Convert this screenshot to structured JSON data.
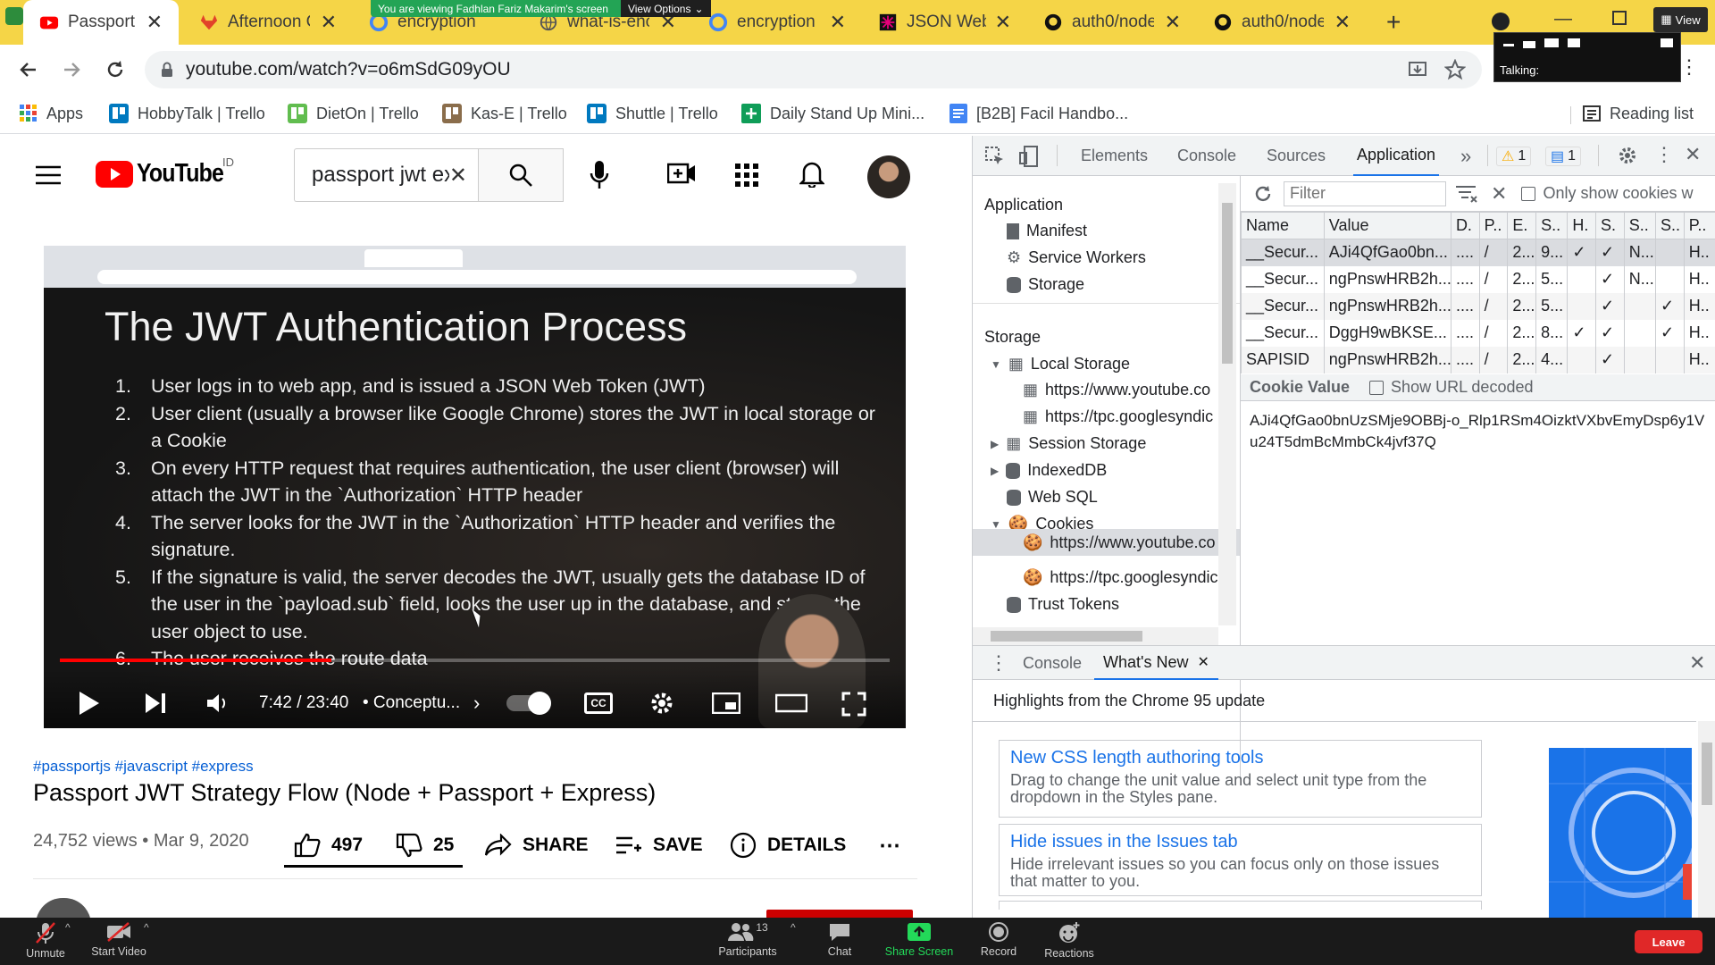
{
  "browser": {
    "tabs": [
      {
        "label": "Passport JW",
        "icon": "youtube-icon",
        "active": true
      },
      {
        "label": "Afternoon C",
        "icon": "gitlab-icon"
      },
      {
        "label": "encryption",
        "icon": "google-icon"
      },
      {
        "label": "what-is-enc",
        "icon": "globe-icon"
      },
      {
        "label": "encryption",
        "icon": "google-icon"
      },
      {
        "label": "JSON Web",
        "icon": "jwt-icon"
      },
      {
        "label": "auth0/node",
        "icon": "github-icon"
      },
      {
        "label": "auth0/node",
        "icon": "github-icon"
      }
    ],
    "url": "youtube.com/watch?v=o6mSdG09yOU",
    "bookmarks": [
      {
        "label": "Apps",
        "icon": "apps-grid-icon"
      },
      {
        "label": "HobbyTalk | Trello",
        "icon": "trello-icon"
      },
      {
        "label": "DietOn | Trello",
        "icon": "trello-icon"
      },
      {
        "label": "Kas-E | Trello",
        "icon": "trello-icon"
      },
      {
        "label": "Shuttle | Trello",
        "icon": "trello-icon"
      },
      {
        "label": "Daily Stand Up Mini...",
        "icon": "sheets-icon"
      },
      {
        "label": "[B2B] Facil Handbo...",
        "icon": "docs-icon"
      }
    ],
    "reading_list": "Reading list"
  },
  "screen_share": {
    "banner": "You are viewing Fadhlan Fariz Makarim's screen",
    "view_options": "View Options",
    "view_label": "View",
    "talking_label": "Talking:"
  },
  "youtube": {
    "logo_text": "YouTube",
    "region": "ID",
    "search_value": "passport jwt ex",
    "video": {
      "slide_title": "The JWT Authentication Process",
      "slide_points": [
        {
          "n": "1.",
          "text": "User logs in to web app, and is issued a JSON Web Token (JWT)"
        },
        {
          "n": "2.",
          "text": "User client (usually a browser like Google Chrome) stores the JWT in local storage or a Cookie"
        },
        {
          "n": "3.",
          "text": "On every HTTP request that requires authentication, the user client (browser) will attach the JWT in the `Authorization` HTTP header"
        },
        {
          "n": "4.",
          "text": "The server looks for the JWT in the `Authorization` HTTP header and verifies the signature."
        },
        {
          "n": "5.",
          "text": "If the signature is valid, the server decodes the JWT, usually gets the database ID of the user in the `payload.sub` field, looks the user up in the database, and stores the user object to use."
        },
        {
          "n": "6.",
          "text": "The user receives the route data"
        }
      ],
      "time": "7:42 / 23:40",
      "chapter": "• Conceptu...",
      "progress": 0.327
    },
    "tags": "#passportjs #javascript #express",
    "title": "Passport JWT Strategy Flow (Node + Passport + Express)",
    "views": "24,752 views • Mar 9, 2020",
    "likes": "497",
    "dislikes": "25",
    "share": "SHARE",
    "save": "SAVE",
    "details": "DETAILS"
  },
  "devtools": {
    "tabs": [
      "Elements",
      "Console",
      "Sources",
      "Application"
    ],
    "active_tab": "Application",
    "warnings": "1",
    "messages": "1",
    "sidebar": {
      "application_header": "Application",
      "application_items": [
        "Manifest",
        "Service Workers",
        "Storage"
      ],
      "storage_header": "Storage",
      "local_storage": "Local Storage",
      "local_items": [
        "https://www.youtube.co",
        "https://tpc.googlesyndic"
      ],
      "session_storage": "Session Storage",
      "indexeddb": "IndexedDB",
      "websql": "Web SQL",
      "cookies": "Cookies",
      "cookie_items": [
        "https://www.youtube.co",
        "https://tpc.googlesyndic"
      ],
      "trust_tokens": "Trust Tokens"
    },
    "filter_placeholder": "Filter",
    "only_show_cookies": "Only show cookies w",
    "columns": [
      "Name",
      "Value",
      "D.",
      "P..",
      "E.",
      "S..",
      "H.",
      "S.",
      "S..",
      "S..",
      "P.."
    ],
    "rows": [
      [
        "__Secur...",
        "AJi4QfGao0bn...",
        "....",
        "/",
        "2...",
        "9...",
        "✓",
        "✓",
        "N...",
        "",
        "H.."
      ],
      [
        "__Secur...",
        "ngPnswHRB2h...",
        "....",
        "/",
        "2...",
        "5...",
        "",
        "✓",
        "N...",
        "",
        "H.."
      ],
      [
        "__Secur...",
        "ngPnswHRB2h...",
        "....",
        "/",
        "2...",
        "5...",
        "",
        "✓",
        "",
        "✓",
        "H.."
      ],
      [
        "__Secur...",
        "DggH9wBKSE...",
        "....",
        "/",
        "2...",
        "8...",
        "✓",
        "✓",
        "",
        "✓",
        "H.."
      ],
      [
        "SAPISID",
        "ngPnswHRB2h...",
        "....",
        "/",
        "2...",
        "4...",
        "",
        "✓",
        "",
        "",
        "H.."
      ]
    ],
    "cookie_value_label": "Cookie Value",
    "show_url_decoded": "Show URL decoded",
    "cookie_value": "AJi4QfGao0bnUzSMje9OBBj-o_Rlp1RSm4OizktVXbvEmyDsp6y1Vu24T5dmBcMmbCk4jvf37Q",
    "drawer_tabs": [
      "Console",
      "What's New"
    ],
    "drawer_headline": "Highlights from the Chrome 95 update",
    "cards": [
      {
        "title": "New CSS length authoring tools",
        "body": "Drag to change the unit value and select unit type from the dropdown in the Styles pane."
      },
      {
        "title": "Hide issues in the Issues tab",
        "body": "Hide irrelevant issues so you can focus only on those issues that matter to you."
      }
    ]
  },
  "zoom": {
    "unmute": "Unmute",
    "start_video": "Start Video",
    "participants": "Participants",
    "participant_count": "13",
    "chat": "Chat",
    "share_screen": "Share Screen",
    "record": "Record",
    "reactions": "Reactions",
    "leave": "Leave"
  },
  "colors": {
    "tabstrip": "#f5d547",
    "youtube_red": "#ff0000",
    "zoom_green": "#23d959",
    "link_blue": "#1a73e8",
    "leave_red": "#e02828"
  }
}
